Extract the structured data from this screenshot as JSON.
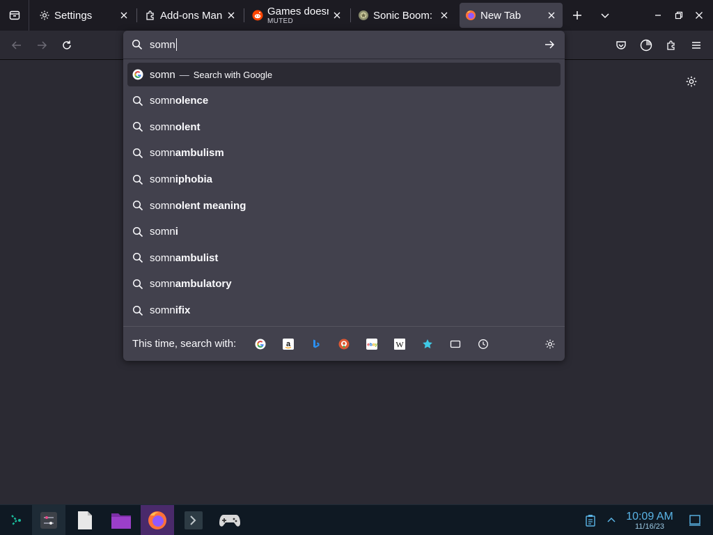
{
  "tabs": [
    {
      "title": "Settings",
      "subtitle": "",
      "icon": "gear-icon"
    },
    {
      "title": "Add-ons Mana",
      "subtitle": "",
      "icon": "puzzle-icon"
    },
    {
      "title": "Games doesn'",
      "subtitle": "MUTED",
      "icon": "reddit-icon"
    },
    {
      "title": "Sonic Boom: S",
      "subtitle": "",
      "icon": "site-icon"
    },
    {
      "title": "New Tab",
      "subtitle": "",
      "icon": "firefox-icon",
      "active": true
    }
  ],
  "urlbar": {
    "value": "somn",
    "first_result": {
      "typed": "somn",
      "action": "Search with Google"
    },
    "suggestions": [
      {
        "typed": "somn",
        "suffix": "olence"
      },
      {
        "typed": "somn",
        "suffix": "olent"
      },
      {
        "typed": "somn",
        "suffix": "ambulism"
      },
      {
        "typed": "somn",
        "suffix": "iphobia"
      },
      {
        "typed": "somn",
        "suffix": "olent meaning"
      },
      {
        "typed": "somn",
        "suffix": "i"
      },
      {
        "typed": "somn",
        "suffix": "ambulist"
      },
      {
        "typed": "somn",
        "suffix": "ambulatory"
      },
      {
        "typed": "somn",
        "suffix": "ifix"
      }
    ],
    "search_with_label": "This time, search with:",
    "engines": [
      "google-icon",
      "amazon-icon",
      "bing-icon",
      "duckduckgo-icon",
      "ebay-icon",
      "wikipedia-icon",
      "bookmarks-icon",
      "tabs-icon",
      "history-icon"
    ]
  },
  "taskbar": {
    "time": "10:09 AM",
    "date": "11/16/23"
  },
  "colors": {
    "accent": "#3daee9",
    "panel": "#42414d",
    "tabstrip": "#1c1b22",
    "background": "#2b2a33"
  }
}
